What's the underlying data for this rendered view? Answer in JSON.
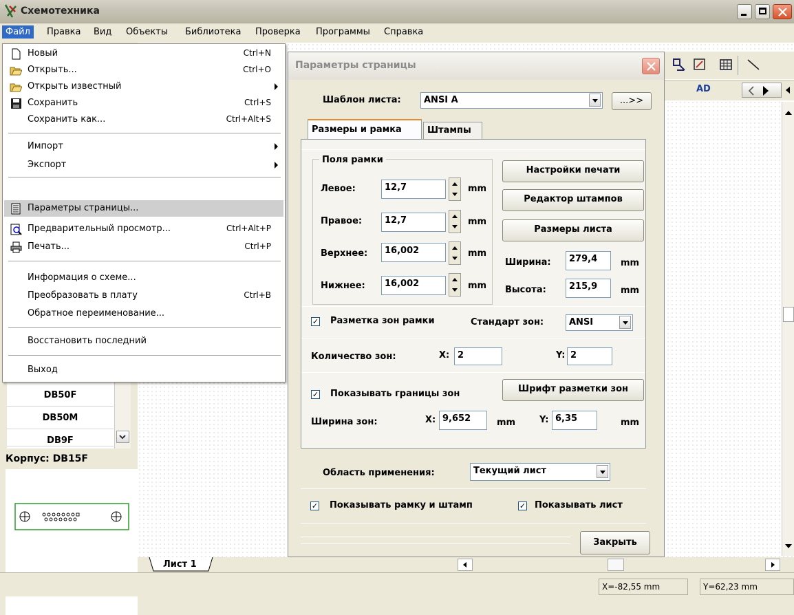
{
  "app": {
    "title": "Схемотехника"
  },
  "menubar": [
    "Файл",
    "Правка",
    "Вид",
    "Объекты",
    "Библиотека",
    "Проверка",
    "Программы",
    "Справка"
  ],
  "file_menu": {
    "items": [
      {
        "label": "Новый",
        "shortcut": "Ctrl+N",
        "icon": "new-file-icon"
      },
      {
        "label": "Открыть...",
        "shortcut": "Ctrl+O",
        "icon": "open-folder-icon"
      },
      {
        "label": "Открыть известный",
        "shortcut": "",
        "icon": "open-folder-icon",
        "submenu": true
      },
      {
        "label": "Сохранить",
        "shortcut": "Ctrl+S",
        "icon": "save-icon"
      },
      {
        "label": "Сохранить как...",
        "shortcut": "Ctrl+Alt+S"
      },
      {
        "label": "Импорт",
        "submenu": true
      },
      {
        "label": "Экспорт",
        "submenu": true
      },
      {
        "label": "Параметры страницы...",
        "shortcut": "",
        "icon": "page-setup-icon",
        "highlighted": true
      },
      {
        "label": "Предварительный просмотр...",
        "shortcut": "Ctrl+Alt+P",
        "icon": "preview-icon"
      },
      {
        "label": "Печать...",
        "shortcut": "Ctrl+P",
        "icon": "print-icon"
      },
      {
        "label": "Информация о схеме..."
      },
      {
        "label": "Преобразовать в плату",
        "shortcut": "Ctrl+B"
      },
      {
        "label": "Обратное переименование..."
      },
      {
        "label": "Восстановить последний"
      },
      {
        "label": "Выход"
      }
    ]
  },
  "left_list": [
    "DB50F",
    "DB50M",
    "DB9F"
  ],
  "package_label": "Корпус: DB15F",
  "sheet_tab": "Лист 1",
  "toolbar": {
    "ad_label": "AD"
  },
  "dialog": {
    "title": "Параметры страницы",
    "template_label": "Шаблон листа:",
    "template_value": "ANSI A",
    "template_button": "...>>",
    "tabs": [
      "Размеры и рамка",
      "Штампы"
    ],
    "frame_group": "Поля рамки",
    "fields": [
      {
        "label": "Левое:",
        "value": "12,7",
        "unit": "mm"
      },
      {
        "label": "Правое:",
        "value": "12,7",
        "unit": "mm"
      },
      {
        "label": "Верхнее:",
        "value": "16,002",
        "unit": "mm"
      },
      {
        "label": "Нижнее:",
        "value": "16,002",
        "unit": "mm"
      }
    ],
    "print_settings": "Настройки печати",
    "stamp_editor": "Редактор штампов",
    "sheet_sizes": "Размеры листа",
    "width_label": "Ширина:",
    "width_value": "279,4",
    "width_unit": "mm",
    "height_label": "Высота:",
    "height_value": "215,9",
    "height_unit": "mm",
    "zones_checkbox": "Разметка зон рамки",
    "zone_standard_label": "Стандарт зон:",
    "zone_standard_value": "ANSI",
    "zone_count_label": "Количество зон:",
    "zone_x_label": "X:",
    "zone_x_value": "2",
    "zone_y_label": "Y:",
    "zone_y_value": "2",
    "show_borders_checkbox": "Показывать границы зон",
    "zone_font_button": "Шрифт разметки зон",
    "zone_width_label": "Ширина зон:",
    "zone_w_x_label": "X:",
    "zone_w_x_value": "9,652",
    "zone_w_x_unit": "mm",
    "zone_w_y_label": "Y:",
    "zone_w_y_value": "6,35",
    "zone_w_y_unit": "mm",
    "scope_label": "Область применения:",
    "scope_value": "Текущий лист",
    "show_frame_checkbox": "Показывать рамку и штамп",
    "show_sheet_checkbox": "Показывать лист",
    "close_button": "Закрыть",
    "check_mark": "✓"
  },
  "status": {
    "x": "X=-82,55 mm",
    "y": "Y=62,23 mm"
  }
}
